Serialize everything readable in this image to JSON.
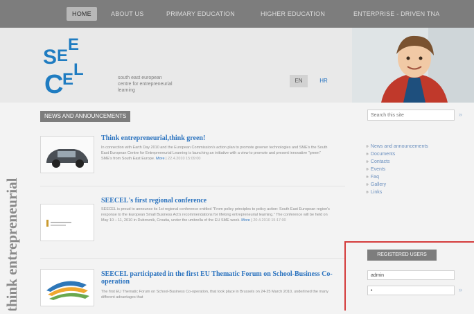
{
  "nav": {
    "home": "HOME",
    "about": "ABOUT US",
    "primary": "PRIMARY EDUCATION",
    "higher": "HIGHER EDUCATION",
    "enterprise": "ENTERPRISE - DRIVEN TNA"
  },
  "logo": {
    "line1": "SEE",
    "line2": "CEL"
  },
  "tagline": [
    "south east european",
    "centre for entrepreneurial",
    "learning"
  ],
  "lang": {
    "en": "EN",
    "hr": "HR"
  },
  "side_vertical_text": "think entrepreneurial",
  "news_label": "NEWS AND ANNOUNCEMENTS",
  "news": [
    {
      "title": "Think entrepreneurial,think green!",
      "body": "In connection with Earth Day 2010 and the European Commission's action plan to promote greener technologies and SME's the South East European Centre for Entrepreneurial Learning is launching an initiative with a view to promote and present innovative \"green\" SME's from South East Europe.",
      "more": "More",
      "date": "22.4.2010 15:09:00"
    },
    {
      "title": "SEECEL's first regional conference",
      "body": "SEECEL is proud to announce its 1st regional conference entitled \"From policy principles to policy action: South East European region's response to the European Small Business Act's recommendations for lifelong entrepreneurial learning.\" The conference will be held on May 10 – 11, 2010 in Dubrovnik, Croatia, under the umbrella of the EU SME week.",
      "more": "More",
      "date": "20.4.2010 15:17:00"
    },
    {
      "title": "SEECEL participated in the first EU Thematic Forum on School-Business Co-operation",
      "body": "The first EU Thematic Forum on School-Business Co-operation, that took place in Brussels on 24-25 March 2010, underlined the many different advantages that"
    }
  ],
  "search": {
    "placeholder": "Search this site"
  },
  "sidebar_links": [
    "News and announcements",
    "Documents",
    "Contacts",
    "Events",
    "Faq",
    "Gallery",
    "Links"
  ],
  "registered": {
    "label": "REGISTERED USERS",
    "username": "admin",
    "password": "•"
  },
  "colors": {
    "nav_bg": "#7d7d7d",
    "link_blue": "#2b73bf",
    "logo_blue": "#1f7cc1",
    "highlight_red": "#d43b3b"
  }
}
